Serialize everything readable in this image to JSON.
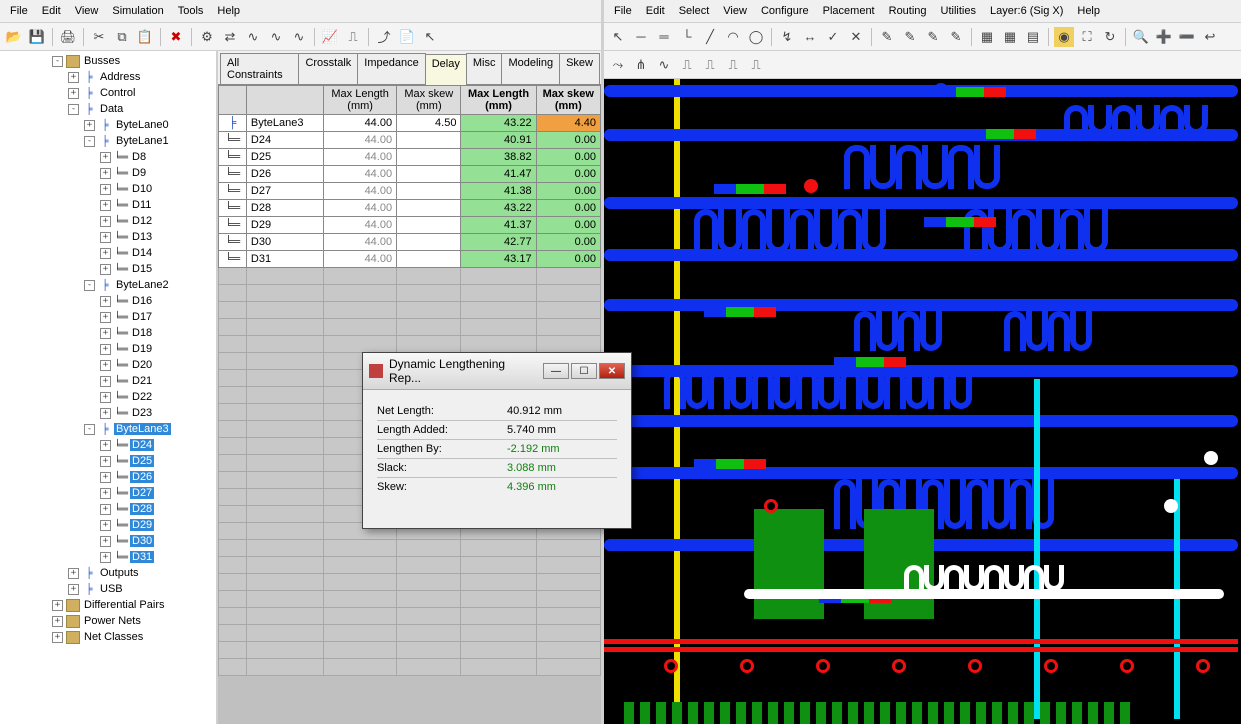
{
  "left": {
    "menu": [
      "File",
      "Edit",
      "View",
      "Simulation",
      "Tools",
      "Help"
    ],
    "tree": {
      "root": "Busses",
      "address": "Address",
      "control": "Control",
      "data": "Data",
      "bl0": "ByteLane0",
      "bl1": "ByteLane1",
      "bl1_nets": [
        "D8",
        "D9",
        "D10",
        "D11",
        "D12",
        "D13",
        "D14",
        "D15"
      ],
      "bl2": "ByteLane2",
      "bl2_nets": [
        "D16",
        "D17",
        "D18",
        "D19",
        "D20",
        "D21",
        "D22",
        "D23"
      ],
      "bl3": "ByteLane3",
      "bl3_nets": [
        "D24",
        "D25",
        "D26",
        "D27",
        "D28",
        "D29",
        "D30",
        "D31"
      ],
      "outputs": "Outputs",
      "usb": "USB",
      "diffpairs": "Differential Pairs",
      "powernets": "Power Nets",
      "netclasses": "Net Classes"
    },
    "tabs": [
      "All Constraints",
      "Crosstalk",
      "Impedance",
      "Delay",
      "Misc",
      "Modeling",
      "Skew"
    ],
    "grid": {
      "headers": [
        "",
        "",
        "Max Length (mm)",
        "Max skew (mm)",
        "Max Length (mm)",
        "Max skew (mm)"
      ],
      "rows": [
        {
          "icon": "bus",
          "name": "ByteLane3",
          "maxlen": "44.00",
          "maxskew": "4.50",
          "mlen": "43.22",
          "mskew": "4.40",
          "skew_orange": true
        },
        {
          "icon": "net",
          "name": "D24",
          "maxlen": "44.00",
          "maxskew": "",
          "mlen": "40.91",
          "mskew": "0.00"
        },
        {
          "icon": "net",
          "name": "D25",
          "maxlen": "44.00",
          "maxskew": "",
          "mlen": "38.82",
          "mskew": "0.00"
        },
        {
          "icon": "net",
          "name": "D26",
          "maxlen": "44.00",
          "maxskew": "",
          "mlen": "41.47",
          "mskew": "0.00"
        },
        {
          "icon": "net",
          "name": "D27",
          "maxlen": "44.00",
          "maxskew": "",
          "mlen": "41.38",
          "mskew": "0.00"
        },
        {
          "icon": "net",
          "name": "D28",
          "maxlen": "44.00",
          "maxskew": "",
          "mlen": "43.22",
          "mskew": "0.00"
        },
        {
          "icon": "net",
          "name": "D29",
          "maxlen": "44.00",
          "maxskew": "",
          "mlen": "41.37",
          "mskew": "0.00"
        },
        {
          "icon": "net",
          "name": "D30",
          "maxlen": "44.00",
          "maxskew": "",
          "mlen": "42.77",
          "mskew": "0.00"
        },
        {
          "icon": "net",
          "name": "D31",
          "maxlen": "44.00",
          "maxskew": "",
          "mlen": "43.17",
          "mskew": "0.00"
        }
      ]
    }
  },
  "right": {
    "menu": [
      "File",
      "Edit",
      "Select",
      "View",
      "Configure",
      "Placement",
      "Routing",
      "Utilities",
      "Layer:6 (Sig X)",
      "Help"
    ]
  },
  "dialog": {
    "title": "Dynamic Lengthening Rep...",
    "rows": [
      {
        "k": "Net Length:",
        "v": "40.912 mm",
        "g": false
      },
      {
        "k": "Length Added:",
        "v": "5.740 mm",
        "g": false
      },
      {
        "k": "Lengthen By:",
        "v": "-2.192 mm",
        "g": true
      },
      {
        "k": "Slack:",
        "v": "3.088 mm",
        "g": true
      },
      {
        "k": "Skew:",
        "v": "4.396 mm",
        "g": true
      }
    ]
  }
}
